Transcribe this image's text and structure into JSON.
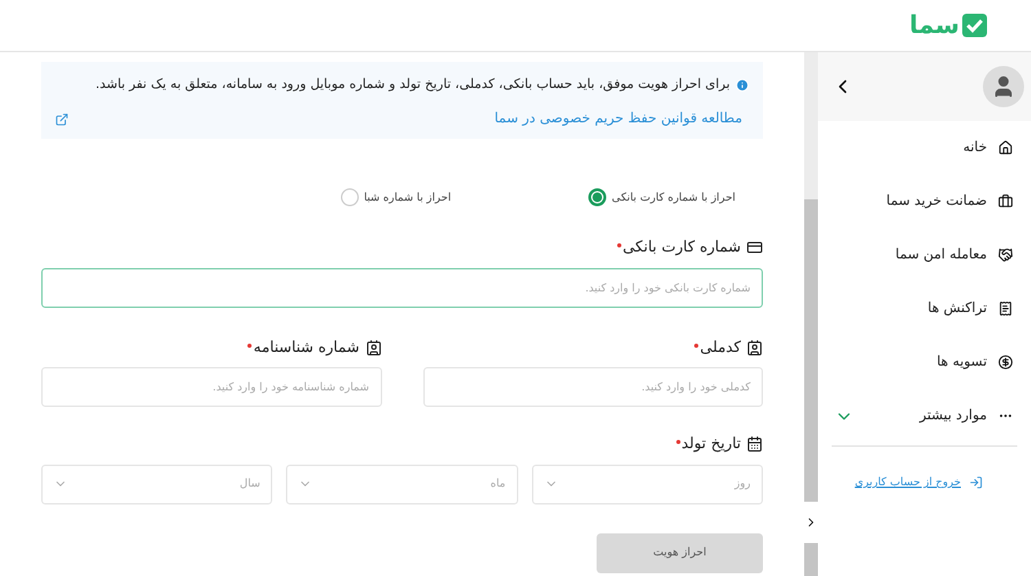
{
  "header": {
    "logo_text": "سما"
  },
  "notice": {
    "text": "برای احراز هویت موفق، باید حساب بانکی، کدملی، تاریخ تولد و شماره موبایل ورود به سامانه، متعلق به یک نفر باشد.",
    "link": "مطالعه قوانین حفظ حریم خصوصی در سما"
  },
  "methods": [
    {
      "label": "احراز با شماره کارت بانکی",
      "selected": true
    },
    {
      "label": "احراز با شماره شبا",
      "selected": false
    }
  ],
  "card_field": {
    "label": "شماره کارت بانکی",
    "required": true,
    "placeholder": "شماره کارت بانکی خود را وارد کنید.",
    "focused": true
  },
  "id_fields": [
    {
      "label": "کدملی",
      "required": true,
      "placeholder": "کدملی خود را وارد کنید."
    },
    {
      "label": "شماره شناسنامه",
      "required": true,
      "placeholder": "شماره شناسنامه خود را وارد کنید."
    }
  ],
  "birth_date": {
    "label": "تاریخ تولد",
    "required": true,
    "selects": [
      {
        "placeholder": "روز"
      },
      {
        "placeholder": "ماه"
      },
      {
        "placeholder": "سال"
      }
    ]
  },
  "submit": {
    "label": "احراز هویت",
    "disabled": true
  },
  "sidebar": {
    "items": [
      {
        "label": "خانه",
        "kind": "home"
      },
      {
        "label": "ضمانت خرید سما",
        "kind": "guarantee"
      },
      {
        "label": "معامله امن سما",
        "kind": "secure"
      },
      {
        "label": "تراکنش ها",
        "kind": "transactions"
      },
      {
        "label": "تسویه ها",
        "kind": "settlement"
      },
      {
        "label": "موارد بیشتر",
        "kind": "more",
        "expanded": false
      }
    ],
    "logout": "خروج از حساب کاربری"
  }
}
